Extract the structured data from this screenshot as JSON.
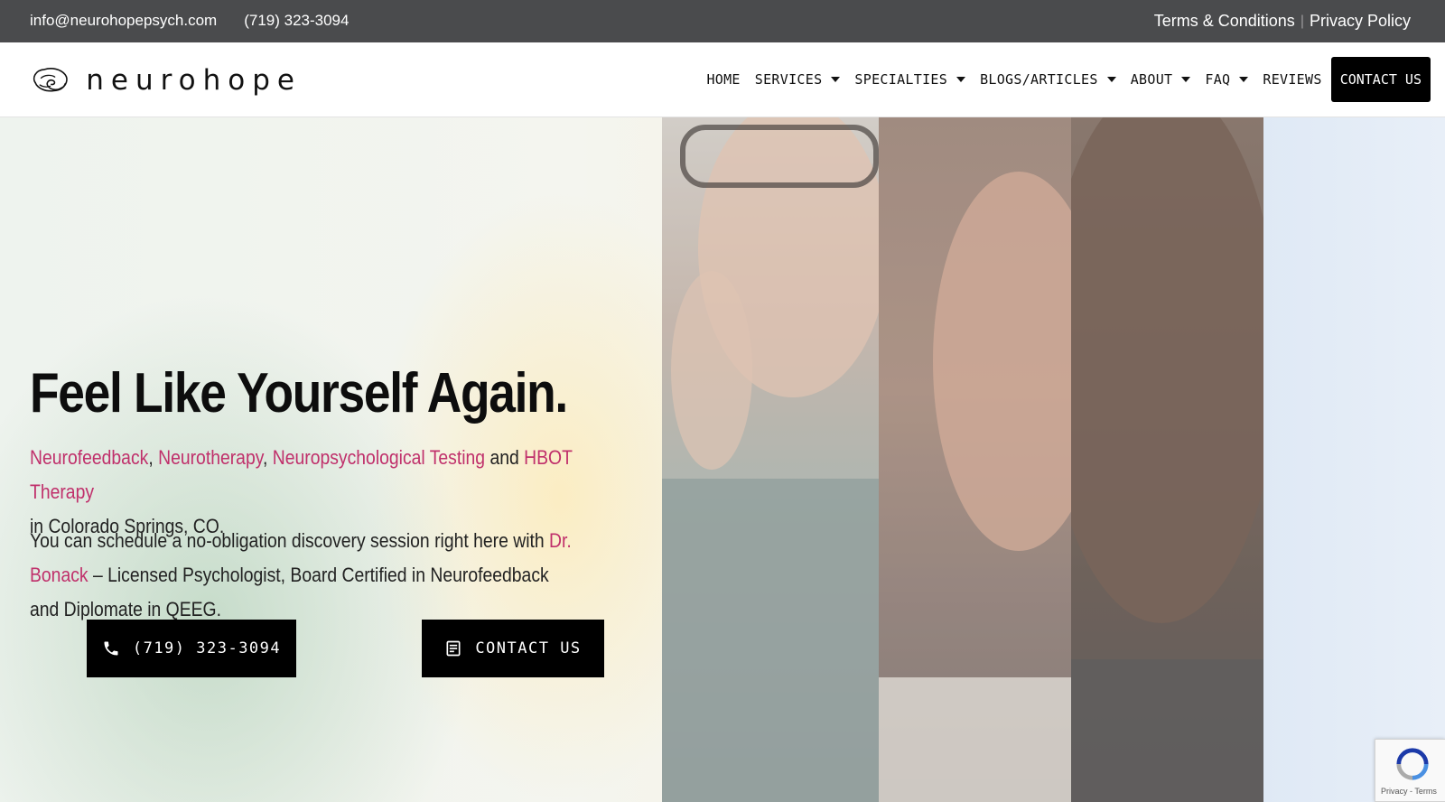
{
  "topbar": {
    "email": "info@neurohopepsych.com",
    "phone": "(719) 323-3094",
    "terms": "Terms & Conditions",
    "separator": "|",
    "privacy": "Privacy Policy"
  },
  "logo": {
    "wordmark": "neurohope"
  },
  "nav": {
    "home": "HOME",
    "services": "SERVICES",
    "specialties": "SPECIALTIES",
    "blogs": "BLOGS/ARTICLES",
    "about": "ABOUT",
    "faq": "FAQ",
    "reviews": "REVIEWS",
    "contact": "CONTACT US"
  },
  "hero": {
    "headline": "Feel Like Yourself Again.",
    "links": {
      "neurofeedback": "Neurofeedback",
      "neurotherapy": "Neurotherapy",
      "neuropsych": "Neuropsychological Testing",
      "hbot": "HBOT Therapy",
      "bonack": "Dr. Bonack"
    },
    "comma": ",",
    "and": " and ",
    "location": "in Colorado Springs, CO.",
    "schedule_prefix": "You can schedule a no-obligation discovery session right here with ",
    "schedule_suffix": " – Licensed Psychologist, Board Certified in Neurofeedback and Diplomate in QEEG.",
    "phone_button": "(719) 323-3094",
    "contact_button": "CONTACT US"
  },
  "recaptcha": {
    "footer": "Privacy - Terms"
  },
  "colors": {
    "topbar": "#4a4b4d",
    "accent_pink": "#c0306b",
    "button": "#000000"
  }
}
